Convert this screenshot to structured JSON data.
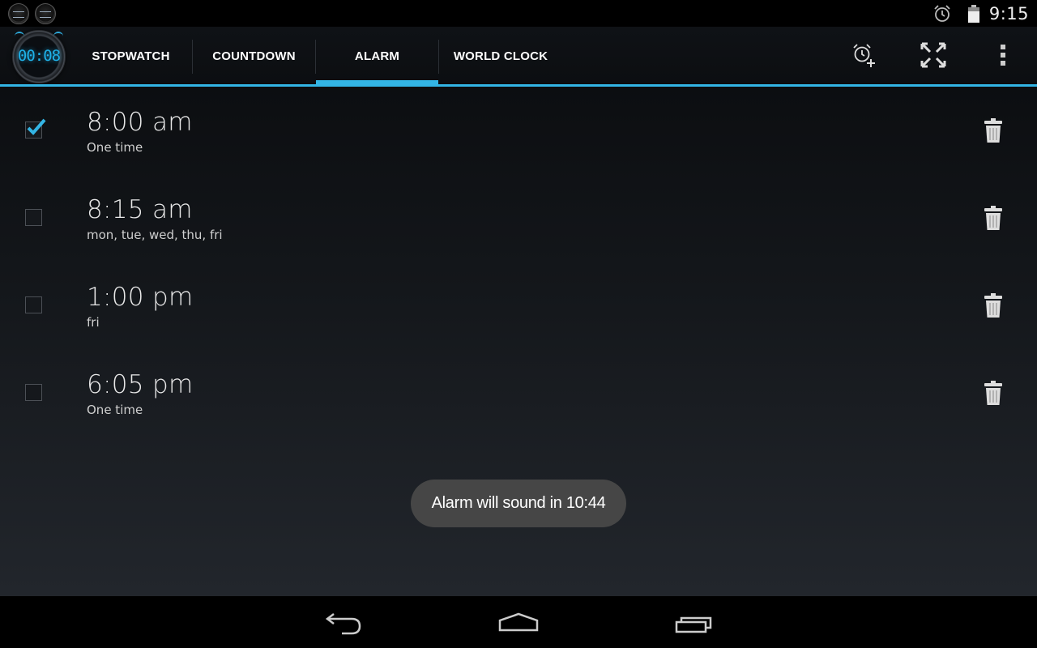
{
  "status_bar": {
    "time": "9:15",
    "icons": [
      "app-notification-icon",
      "app-notification-icon",
      "alarm-icon",
      "battery-icon"
    ]
  },
  "action_bar": {
    "app_logo_time": "00:08",
    "tabs": [
      {
        "label": "STOPWATCH",
        "selected": false
      },
      {
        "label": "COUNTDOWN",
        "selected": false
      },
      {
        "label": "ALARM",
        "selected": true
      },
      {
        "label": "WORLD CLOCK",
        "selected": false
      }
    ],
    "actions": [
      "add-alarm-icon",
      "fullscreen-icon",
      "overflow-menu-icon"
    ],
    "accent_color": "#33b5e5"
  },
  "alarms": [
    {
      "time": "8:00 am",
      "days": "One time",
      "enabled": true
    },
    {
      "time": "8:15 am",
      "days": "mon, tue, wed, thu, fri",
      "enabled": false
    },
    {
      "time": "1:00 pm",
      "days": "fri",
      "enabled": false
    },
    {
      "time": "6:05 pm",
      "days": "One time",
      "enabled": false
    }
  ],
  "toast": {
    "message": "Alarm will sound in 10:44"
  },
  "nav_bar": {
    "buttons": [
      "back-icon",
      "home-icon",
      "recent-apps-icon"
    ]
  }
}
